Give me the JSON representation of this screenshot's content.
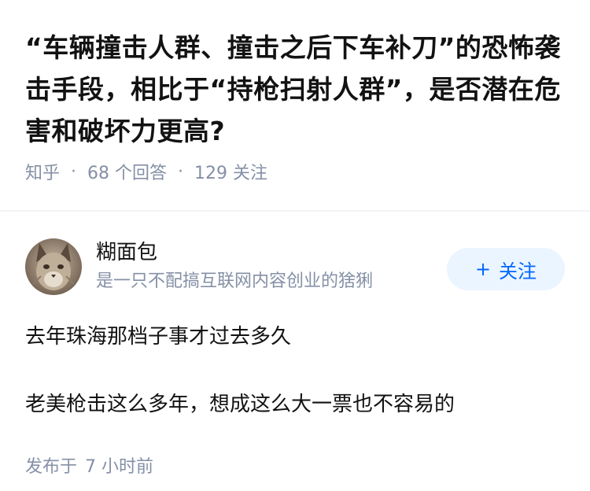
{
  "question": {
    "title": "“车辆撞击人群、撞击之后下车补刀”的恐怖袭击手段，相比于“持枪扫射人群”，是否潜在危害和破坏力更高?",
    "source": "知乎",
    "answers_count": "68 个回答",
    "followers_count": "129 关注"
  },
  "author": {
    "avatar_icon": "lynx-avatar",
    "name": "糊面包",
    "bio": "是一只不配搞互联网内容创业的猞猁",
    "follow_label": "关注",
    "follow_icon": "plus-icon"
  },
  "answer": {
    "paragraph1": "去年珠海那档子事才过去多久",
    "paragraph2": "老美枪击这么多年，想成这么大一票也不容易的",
    "publish_label": "发布于",
    "publish_time": "7 小时前"
  }
}
